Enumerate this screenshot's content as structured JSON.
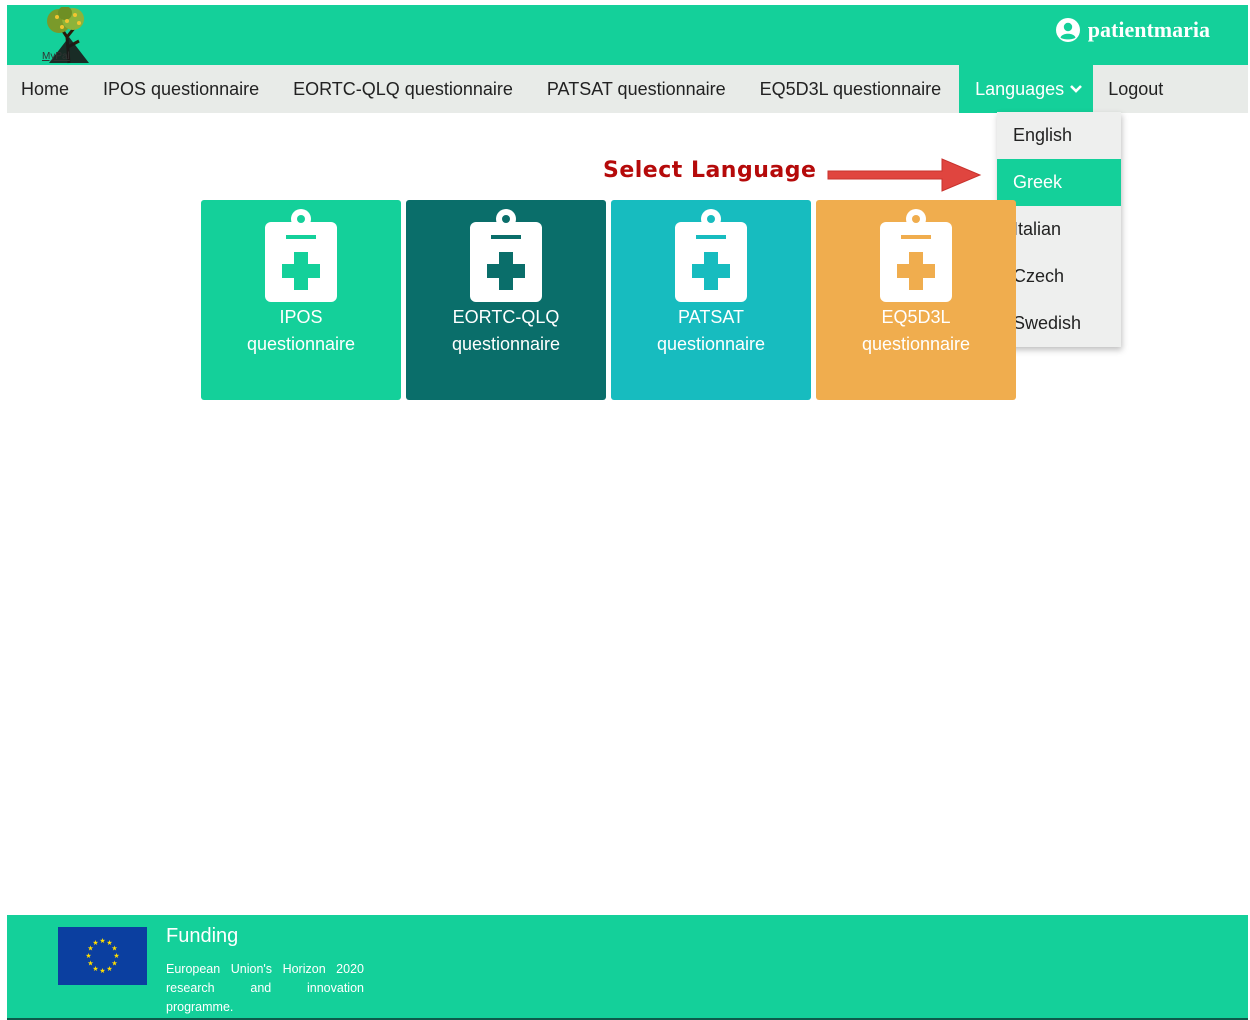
{
  "header": {
    "logo_text": "MyPal",
    "username": "patientmaria"
  },
  "nav": {
    "items": [
      {
        "label": "Home"
      },
      {
        "label": "IPOS questionnaire"
      },
      {
        "label": "EORTC-QLQ questionnaire"
      },
      {
        "label": "PATSAT questionnaire"
      },
      {
        "label": "EQ5D3L questionnaire"
      }
    ],
    "languages_label": "Languages",
    "logout_label": "Logout"
  },
  "language_menu": {
    "items": [
      "English",
      "Greek",
      "Italian",
      "Czech",
      "Swedish"
    ],
    "highlighted": "Greek"
  },
  "annotation": {
    "text": "Select Language",
    "color": "#b50a0a",
    "arrow_color": "#e0453f"
  },
  "cards": [
    {
      "line1": "IPOS",
      "line2": "questionnaire",
      "color": "#14d09a"
    },
    {
      "line1": "EORTC-QLQ",
      "line2": "questionnaire",
      "color": "#0a6e6a"
    },
    {
      "line1": "PATSAT",
      "line2": "questionnaire",
      "color": "#17bcbf"
    },
    {
      "line1": "EQ5D3L",
      "line2": "questionnaire",
      "color": "#f0ad4e"
    }
  ],
  "footer": {
    "title": "Funding",
    "text": "European Union's Horizon 2020 research and innovation programme."
  },
  "colors": {
    "brand": "#14d09a",
    "nav_background": "#e8ebe8"
  }
}
